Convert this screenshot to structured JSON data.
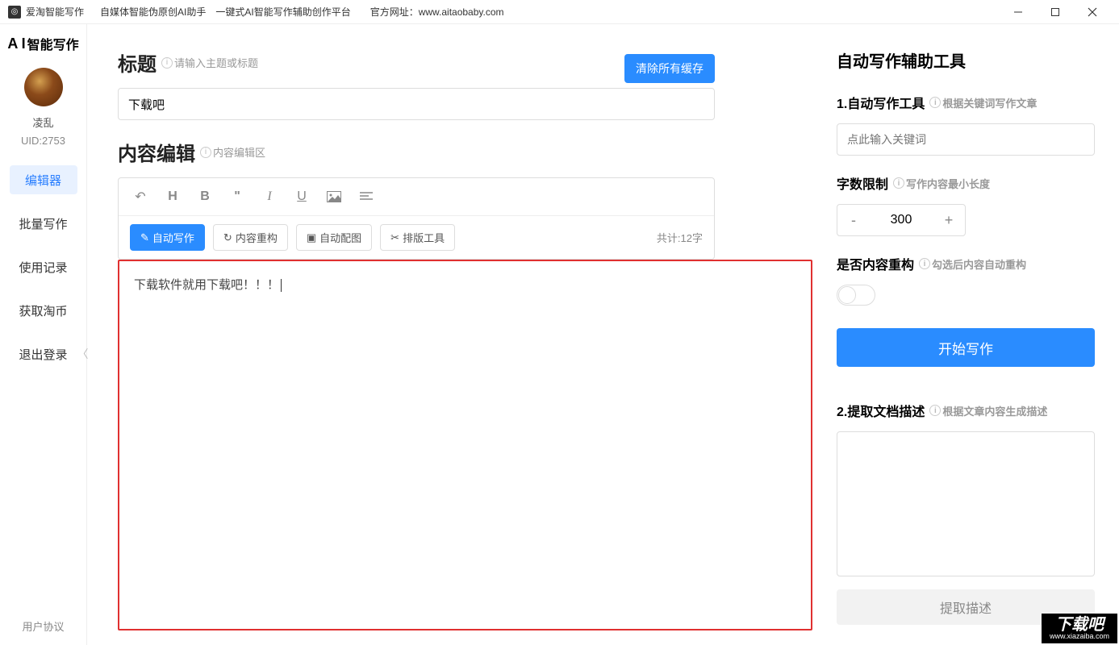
{
  "titlebar": {
    "app_name": "爱淘智能写作",
    "info": "自媒体智能伪原创AI助手　一键式AI智能写作辅助创作平台　　官方网址：www.aitaobaby.com"
  },
  "sidebar": {
    "logo_text": "智能写作",
    "username": "凌乱",
    "uid": "UID:2753",
    "nav": [
      "编辑器",
      "批量写作",
      "使用记录",
      "获取淘币",
      "退出登录"
    ],
    "footer": "用户协议"
  },
  "editor": {
    "title_label": "标题",
    "title_hint": "请输入主题或标题",
    "clear_btn": "清除所有缓存",
    "title_value": "下载吧",
    "content_label": "内容编辑",
    "content_hint": "内容编辑区",
    "btn_auto": "自动写作",
    "btn_restruct": "内容重构",
    "btn_image": "自动配图",
    "btn_layout": "排版工具",
    "word_count": "共计:12字",
    "content_text": "下载软件就用下载吧！！！"
  },
  "right": {
    "panel_title": "自动写作辅助工具",
    "sec1_title": "1.自动写作工具",
    "sec1_hint": "根据关键词写作文章",
    "keyword_placeholder": "点此输入关键词",
    "wordlimit_label": "字数限制",
    "wordlimit_hint": "写作内容最小长度",
    "wordlimit_value": "300",
    "restruct_label": "是否内容重构",
    "restruct_hint": "勾选后内容自动重构",
    "start_btn": "开始写作",
    "sec2_title": "2.提取文档描述",
    "sec2_hint": "根据文章内容生成描述",
    "extract_btn": "提取描述"
  },
  "watermark": {
    "main": "下载吧",
    "sub": "www.xiazaiba.com"
  }
}
